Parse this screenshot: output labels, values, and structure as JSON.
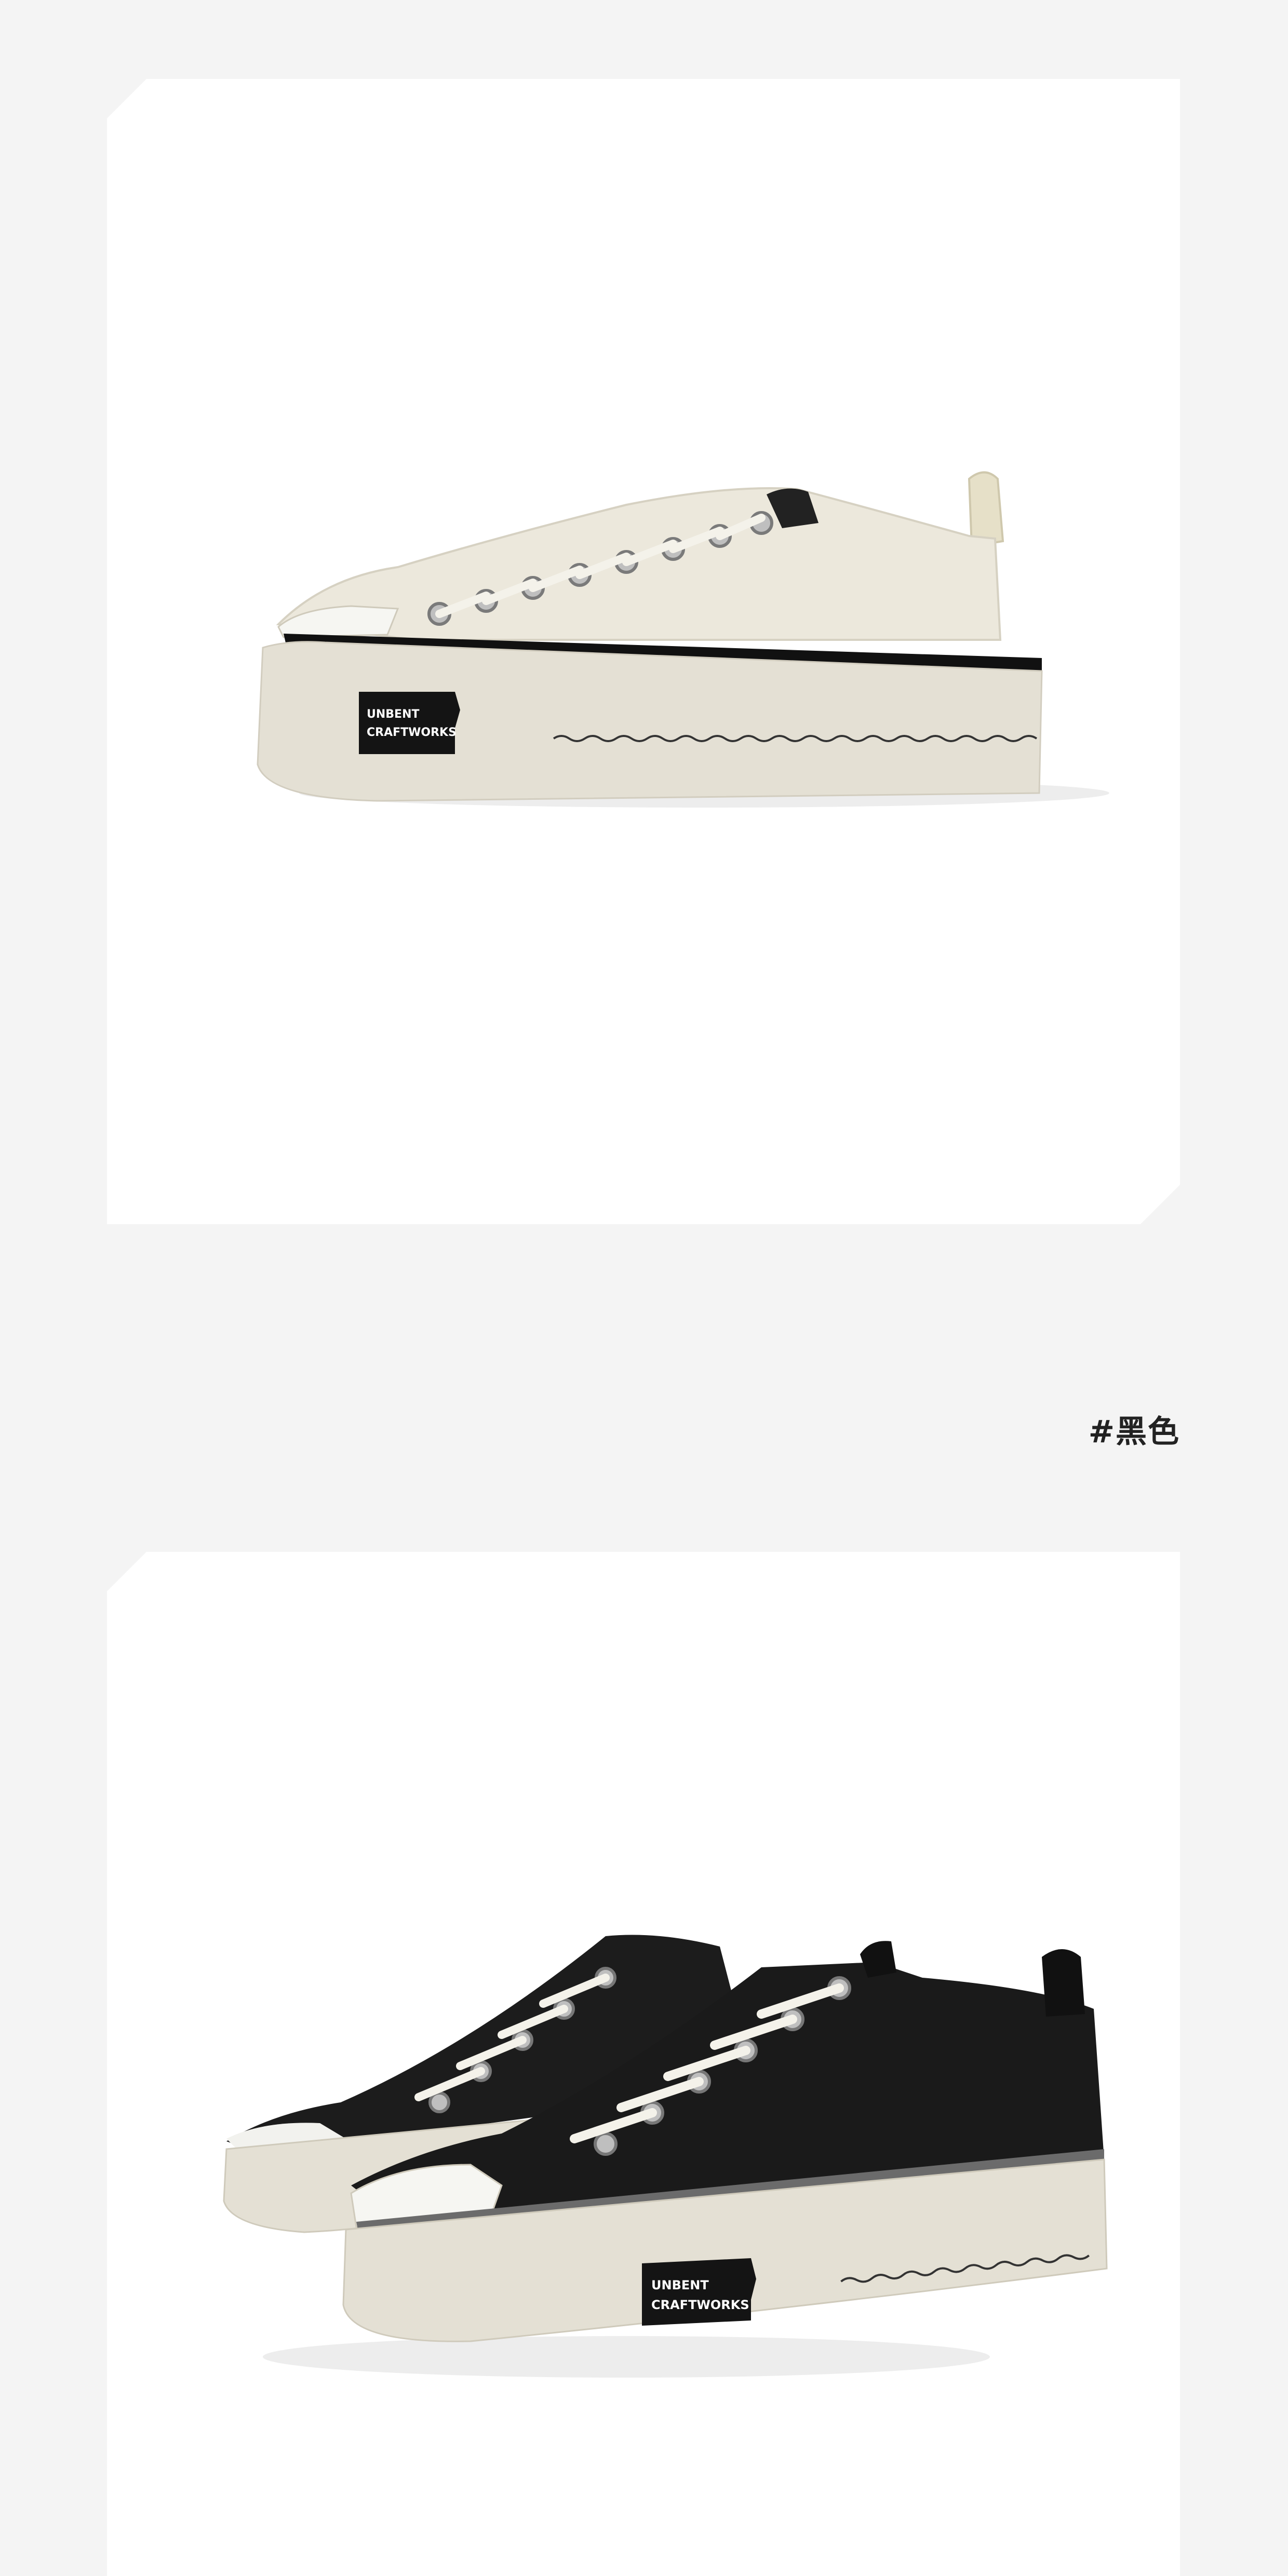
{
  "sections": [
    {
      "image": "white-low-top-canvas-sneaker-side-view"
    },
    {
      "color_label": "#黑色",
      "image": "black-low-top-canvas-sneakers-pair"
    }
  ],
  "patch": {
    "line1": "UNBENT",
    "line2": "CRAFTWORKS"
  },
  "colors": {
    "page_bg": "#f4f4f4",
    "card_bg": "#ffffff",
    "canvas_white": "#ece9df",
    "canvas_black": "#1c1c1c",
    "sole": "#e4e0d4"
  }
}
